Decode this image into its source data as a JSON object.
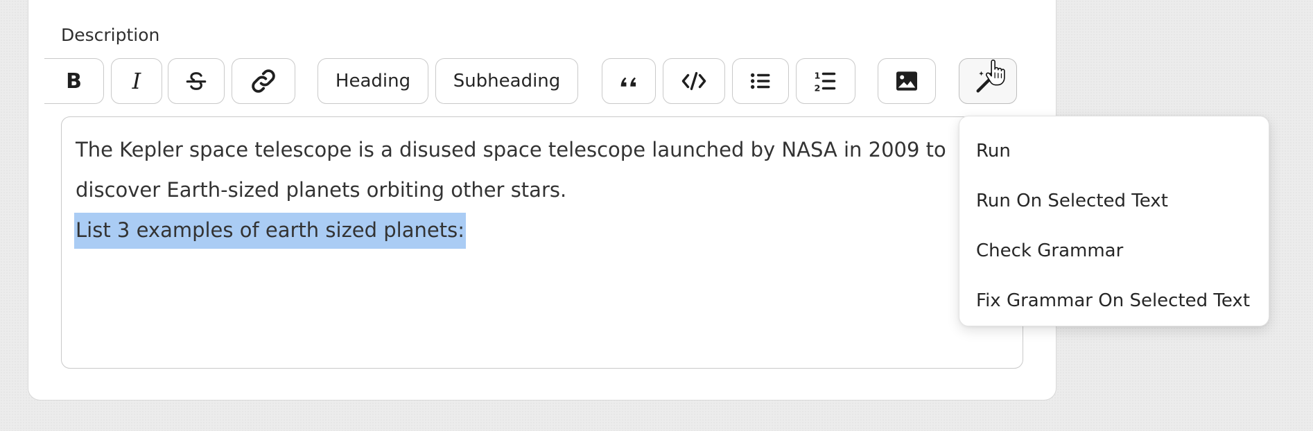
{
  "description_label": "Description",
  "toolbar": {
    "bold": "B",
    "italic": "I",
    "heading_label": "Heading",
    "subheading_label": "Subheading",
    "icons": [
      "bold-icon",
      "italic-icon",
      "strikethrough-icon",
      "link-icon",
      "quote-icon",
      "code-icon",
      "bullet-list-icon",
      "numbered-list-icon",
      "image-icon",
      "magic-wand-icon"
    ]
  },
  "editor": {
    "lines": [
      "The Kepler space telescope is a disused space telescope launched by NASA in 2009 to",
      "discover Earth-sized planets orbiting other stars.",
      "List 3 examples of earth sized planets:"
    ],
    "selected_line_index": 2,
    "selection_color": "#aaccf4"
  },
  "ai_menu": {
    "items": [
      {
        "label": "Run"
      },
      {
        "label": "Run On Selected Text"
      },
      {
        "label": "Check Grammar"
      },
      {
        "label": "Fix Grammar On Selected Text"
      }
    ]
  }
}
